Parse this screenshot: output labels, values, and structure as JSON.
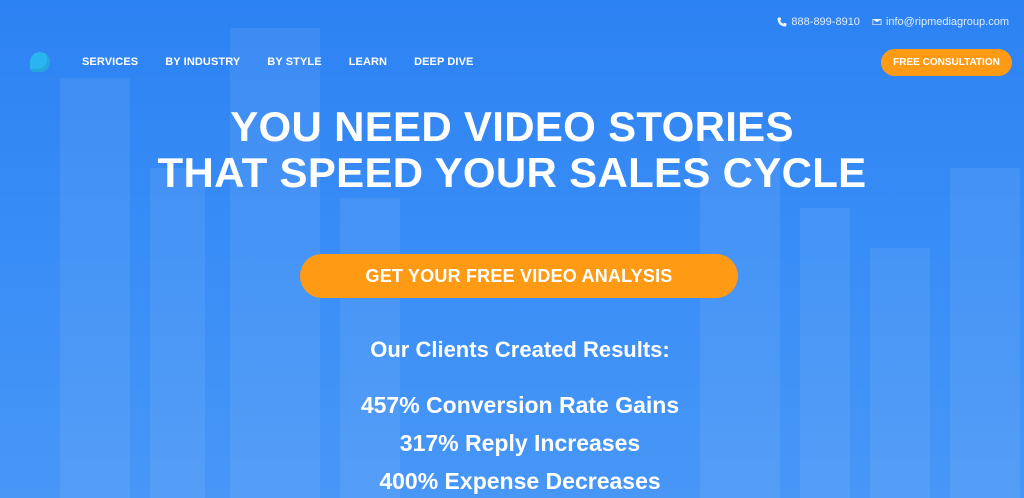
{
  "topbar": {
    "phone": "888-899-8910",
    "email": "info@ripmediagroup.com",
    "phone_icon": "phone-icon",
    "email_icon": "envelope-icon"
  },
  "logo": {
    "icon": "logo-icon",
    "color": "#2ab5f0"
  },
  "nav": {
    "items": [
      "SERVICES",
      "BY INDUSTRY",
      "BY STYLE",
      "LEARN",
      "DEEP DIVE"
    ]
  },
  "header_cta": {
    "label": "FREE CONSULTATION"
  },
  "hero": {
    "headline_line1": "YOU NEED VIDEO STORIES",
    "headline_line2": "THAT SPEED YOUR SALES CYCLE",
    "cta_label": "GET YOUR FREE VIDEO ANALYSIS"
  },
  "results": {
    "title": "Our Clients Created Results:",
    "stats": [
      "457% Conversion Rate Gains",
      "317% Reply Increases",
      "400% Expense Decreases"
    ]
  },
  "colors": {
    "background": "#2f86f4",
    "accent_orange": "#ff9a14",
    "text": "#ffffff"
  }
}
